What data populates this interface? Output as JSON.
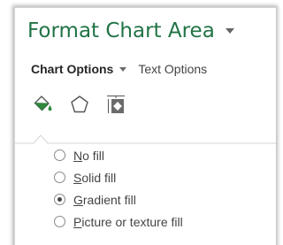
{
  "pane": {
    "title": "Format Chart Area",
    "title_dropdown_icon": "caret-down-icon"
  },
  "tabs": [
    {
      "label": "Chart Options",
      "active": true
    },
    {
      "label": "Text Options",
      "active": false
    }
  ],
  "category_icons": [
    {
      "name": "fill-line-icon",
      "selected": true
    },
    {
      "name": "effects-pentagon-icon",
      "selected": false
    },
    {
      "name": "size-properties-icon",
      "selected": false
    }
  ],
  "fill_options": [
    {
      "access_key": "N",
      "rest": "o fill",
      "label": "No fill",
      "checked": false
    },
    {
      "access_key": "S",
      "rest": "olid fill",
      "label": "Solid fill",
      "checked": false
    },
    {
      "access_key": "G",
      "rest": "radient fill",
      "label": "Gradient fill",
      "checked": true
    },
    {
      "access_key": "P",
      "rest": "icture or texture fill",
      "label": "Picture or texture fill",
      "checked": false
    }
  ],
  "colors": {
    "title_green": "#217346",
    "bucket_fill_green": "#2e8b3e",
    "text_gray": "#444444"
  }
}
